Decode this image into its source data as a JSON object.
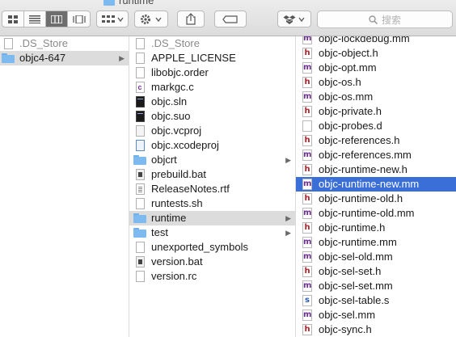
{
  "window": {
    "title": "runtime"
  },
  "toolbar": {
    "view_buttons": [
      "icon-view",
      "list-view",
      "column-view",
      "cover-flow-view"
    ],
    "active_view": "column-view",
    "arrange_icon": "grid-arrange-icon",
    "action_icon": "gear-icon",
    "share_icon": "share-icon",
    "tag_icon": "tag-icon",
    "dropbox_icon": "dropbox-icon",
    "search_placeholder": "搜索"
  },
  "colors": {
    "selection": "#3a6fd8",
    "path_highlight": "#dcdcdc",
    "folder": "#7dbaf0"
  },
  "column1": {
    "items": [
      {
        "label": ".DS_Store",
        "kind": "file",
        "dim": true
      },
      {
        "label": "objc4-647",
        "kind": "folder",
        "state": "path",
        "arrow": true
      }
    ]
  },
  "column2": {
    "items": [
      {
        "label": ".DS_Store",
        "kind": "file",
        "dim": true
      },
      {
        "label": "APPLE_LICENSE",
        "kind": "file"
      },
      {
        "label": "libobjc.order",
        "kind": "file"
      },
      {
        "label": "markgc.c",
        "kind": "c"
      },
      {
        "label": "objc.sln",
        "kind": "sln"
      },
      {
        "label": "objc.suo",
        "kind": "sln"
      },
      {
        "label": "objc.vcproj",
        "kind": "vc"
      },
      {
        "label": "objc.xcodeproj",
        "kind": "xp"
      },
      {
        "label": "objcrt",
        "kind": "folder",
        "arrow": true
      },
      {
        "label": "prebuild.bat",
        "kind": "bat"
      },
      {
        "label": "ReleaseNotes.rtf",
        "kind": "rtf"
      },
      {
        "label": "runtests.sh",
        "kind": "file"
      },
      {
        "label": "runtime",
        "kind": "folder",
        "state": "path",
        "arrow": true
      },
      {
        "label": "test",
        "kind": "folder",
        "arrow": true
      },
      {
        "label": "unexported_symbols",
        "kind": "file"
      },
      {
        "label": "version.bat",
        "kind": "bat"
      },
      {
        "label": "version.rc",
        "kind": "file"
      }
    ]
  },
  "column3": {
    "items": [
      {
        "label": "objc-lockdebug.mm",
        "kind": "m",
        "cut": true
      },
      {
        "label": "objc-object.h",
        "kind": "h"
      },
      {
        "label": "objc-opt.mm",
        "kind": "m"
      },
      {
        "label": "objc-os.h",
        "kind": "h"
      },
      {
        "label": "objc-os.mm",
        "kind": "m"
      },
      {
        "label": "objc-private.h",
        "kind": "h"
      },
      {
        "label": "objc-probes.d",
        "kind": "d"
      },
      {
        "label": "objc-references.h",
        "kind": "h"
      },
      {
        "label": "objc-references.mm",
        "kind": "m"
      },
      {
        "label": "objc-runtime-new.h",
        "kind": "h"
      },
      {
        "label": "objc-runtime-new.mm",
        "kind": "m",
        "state": "sel"
      },
      {
        "label": "objc-runtime-old.h",
        "kind": "h"
      },
      {
        "label": "objc-runtime-old.mm",
        "kind": "m"
      },
      {
        "label": "objc-runtime.h",
        "kind": "h"
      },
      {
        "label": "objc-runtime.mm",
        "kind": "m"
      },
      {
        "label": "objc-sel-old.mm",
        "kind": "m"
      },
      {
        "label": "objc-sel-set.h",
        "kind": "h"
      },
      {
        "label": "objc-sel-set.mm",
        "kind": "m"
      },
      {
        "label": "objc-sel-table.s",
        "kind": "s"
      },
      {
        "label": "objc-sel.mm",
        "kind": "m"
      },
      {
        "label": "objc-sync.h",
        "kind": "h"
      }
    ]
  }
}
